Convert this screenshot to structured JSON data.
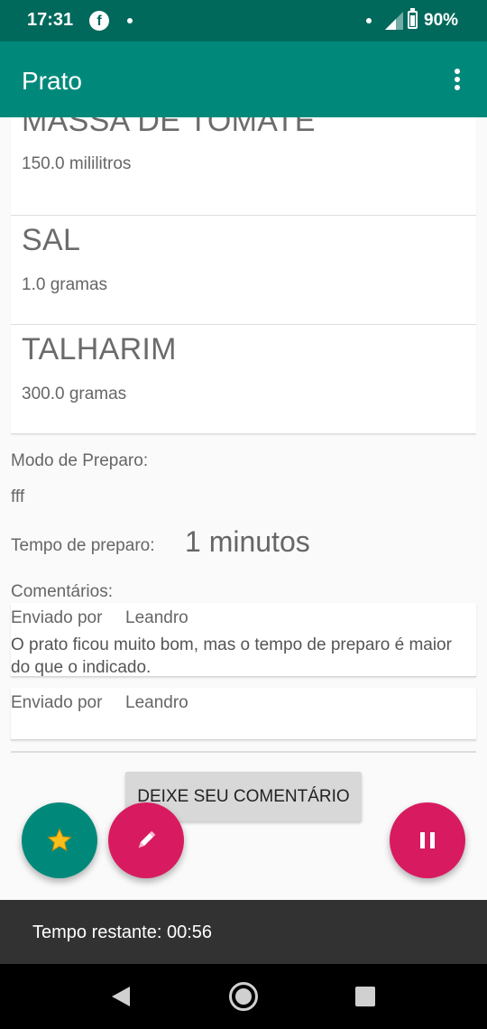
{
  "status_bar": {
    "time": "17:31",
    "battery": "90%",
    "app_icon": "facebook-icon"
  },
  "app_bar": {
    "title": "Prato",
    "menu_icon": "overflow-menu-icon"
  },
  "ingredients": [
    {
      "name": "MASSA DE TOMATE",
      "quantity": "150.0 mililitros"
    },
    {
      "name": "SAL",
      "quantity": "1.0 gramas"
    },
    {
      "name": "TALHARIM",
      "quantity": "300.0 gramas"
    }
  ],
  "preparation": {
    "label": "Modo de Preparo:",
    "text": "fff"
  },
  "prep_time": {
    "label": "Tempo de preparo:",
    "value": "1 minutos"
  },
  "comments": {
    "label": "Comentários:",
    "items": [
      {
        "sender_label": "Enviado por",
        "sender": "Leandro",
        "text": "O prato ficou muito bom, mas o tempo de preparo é maior do que o indicado."
      },
      {
        "sender_label": "Enviado por",
        "sender": "Leandro",
        "text": ""
      }
    ],
    "button_label": "DEIXE SEU COMENTÁRIO"
  },
  "fabs": {
    "favorite_icon": "star-icon",
    "edit_icon": "pencil-icon",
    "timer_icon": "pause-icon"
  },
  "colors": {
    "primary": "#00897b",
    "primary_dark": "#00695c",
    "accent": "#d81b60",
    "star": "#f9c01c"
  },
  "snackbar": {
    "text": "Tempo restante: 00:56"
  }
}
